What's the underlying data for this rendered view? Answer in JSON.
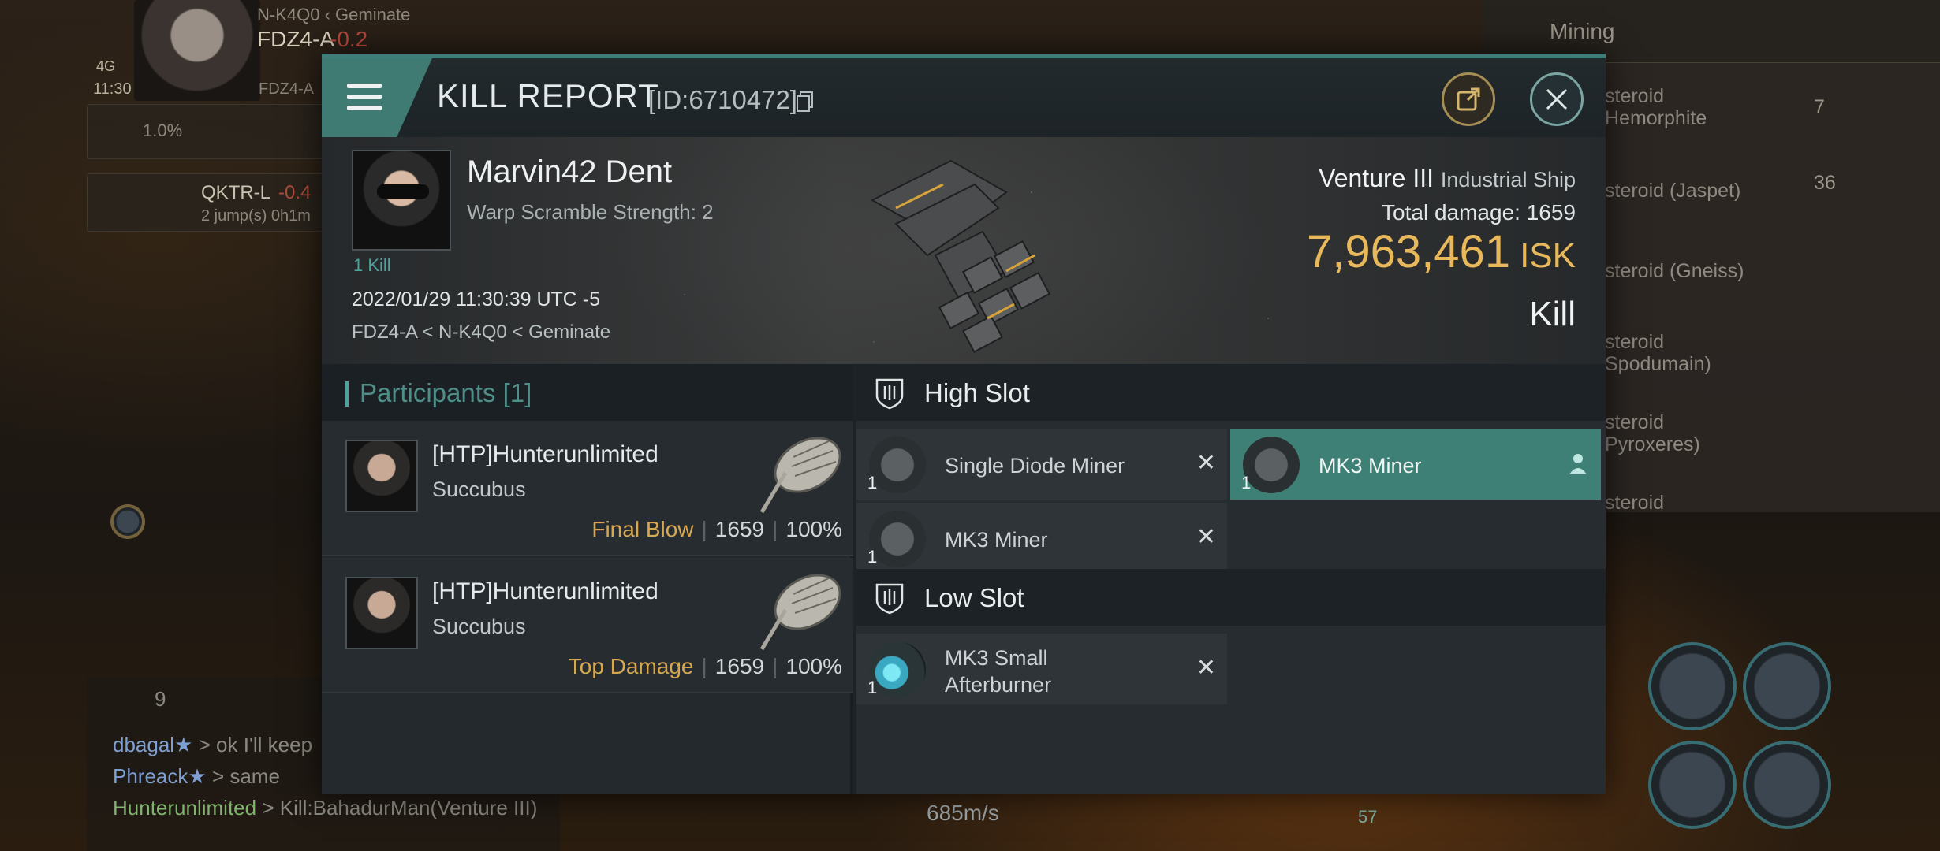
{
  "background": {
    "top_left": {
      "location_line": "N-K4Q0 ‹ Geminate",
      "system": "FDZ4-A",
      "security": "-0.2",
      "time": "11:30",
      "network": "4G",
      "system_small": "FDZ4-A",
      "cargo_pct": "1.0%",
      "dest_system": "QKTR-L",
      "dest_sec": "-0.4",
      "jumps": "2 jump(s) 0h1m"
    },
    "overview": {
      "tab": "Mining",
      "rows": [
        {
          "name": "steroid\nHemorphite",
          "count": "7"
        },
        {
          "name": "steroid (Jaspet)",
          "count": "36"
        },
        {
          "name": "steroid (Gneiss)",
          "count": ""
        },
        {
          "name": "steroid\nSpodumain)",
          "count": ""
        },
        {
          "name": "steroid\nPyroxeres)",
          "count": ""
        },
        {
          "name": "steroid",
          "count": ""
        }
      ]
    },
    "chat": {
      "members": "9",
      "lines": [
        {
          "name": "dbagal★",
          "text": "> ok I'll keep"
        },
        {
          "name": "Phreack★",
          "text": "> same"
        },
        {
          "name": "Hunterunlimited",
          "text": "> Kill:BahadurMan(Venture III)"
        }
      ]
    },
    "speed": "685m/s",
    "badge_count": "57"
  },
  "modal": {
    "title": "KILL REPORT",
    "id": "[ID:6710472]",
    "victim": {
      "name": "Marvin42 Dent",
      "warp_scramble": "Warp Scramble Strength: 2",
      "kills": "1 Kill",
      "date": "2022/01/29 11:30:39 UTC -5",
      "location": "FDZ4-A < N-K4Q0 < Geminate"
    },
    "ship": {
      "name": "Venture III",
      "class": "Industrial Ship",
      "total_damage_label": "Total damage:",
      "total_damage": "1659",
      "isk_value": "7,963,461",
      "isk_unit": "ISK",
      "result": "Kill"
    },
    "participants": {
      "header": "Participants [1]",
      "rows": [
        {
          "name": "[HTP]Hunterunlimited",
          "ship": "Succubus",
          "tag": "Final Blow",
          "damage": "1659",
          "percent": "100%"
        },
        {
          "name": "[HTP]Hunterunlimited",
          "ship": "Succubus",
          "tag": "Top Damage",
          "damage": "1659",
          "percent": "100%"
        }
      ]
    },
    "fitting": {
      "high_slot_label": "High Slot",
      "low_slot_label": "Low Slot",
      "high": [
        {
          "name": "Single Diode Miner",
          "qty": "1"
        },
        {
          "name": "MK3 Miner",
          "qty": "1"
        },
        {
          "name": "MK3 Miner",
          "qty": "1"
        }
      ],
      "low": [
        {
          "name_line1": "MK3 Small",
          "name_line2": "Afterburner",
          "qty": "1"
        }
      ]
    }
  },
  "colors": {
    "accent": "#3f7e78",
    "isk": "#e8b85a",
    "tag": "#d7a850",
    "selected_module": "#3e8076"
  }
}
